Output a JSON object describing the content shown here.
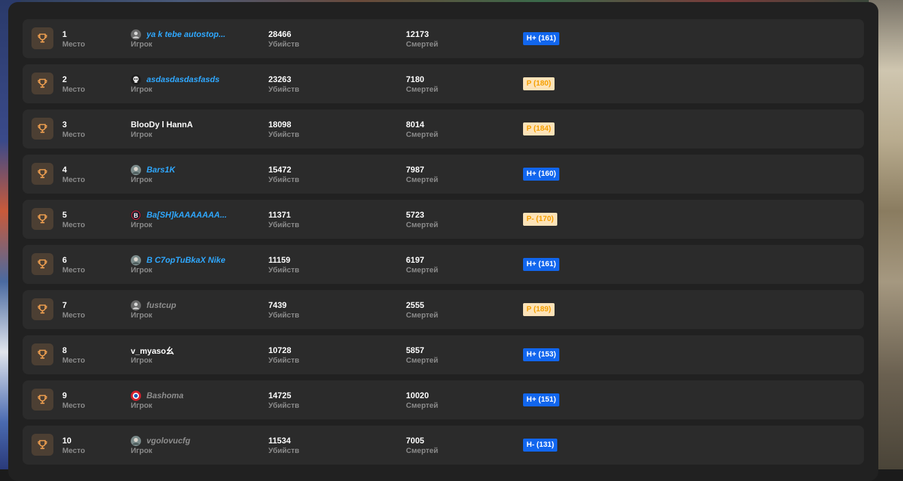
{
  "labels": {
    "place": "Место",
    "player": "Игрок",
    "kills": "Убийств",
    "deaths": "Смертей"
  },
  "rows": [
    {
      "place": "1",
      "player": "ya k tebe autostop...",
      "player_style": "link",
      "avatar": "default-avatar-icon",
      "kills": "28466",
      "deaths": "12173",
      "rank": "H+ (161)",
      "rank_color": "blue"
    },
    {
      "place": "2",
      "player": "asdasdasdasfasds",
      "player_style": "link",
      "avatar": "skull-avatar-icon",
      "kills": "23263",
      "deaths": "7180",
      "rank": "P (180)",
      "rank_color": "orange"
    },
    {
      "place": "3",
      "player": "BlooDy l HannA",
      "player_style": "plain",
      "avatar": "",
      "kills": "18098",
      "deaths": "8014",
      "rank": "P (184)",
      "rank_color": "orange"
    },
    {
      "place": "4",
      "player": "Bars1K",
      "player_style": "link",
      "avatar": "photo-avatar-icon",
      "kills": "15472",
      "deaths": "7987",
      "rank": "H+ (160)",
      "rank_color": "blue"
    },
    {
      "place": "5",
      "player": "Ba[SH]kAAAAAAA...",
      "player_style": "link",
      "avatar": "letter-b-avatar-icon",
      "kills": "11371",
      "deaths": "5723",
      "rank": "P- (170)",
      "rank_color": "orange"
    },
    {
      "place": "6",
      "player": "B C7opTuBkaX Nike",
      "player_style": "link",
      "avatar": "photo-avatar-icon",
      "kills": "11159",
      "deaths": "6197",
      "rank": "H+ (161)",
      "rank_color": "blue"
    },
    {
      "place": "7",
      "player": "fustcup",
      "player_style": "gray",
      "avatar": "default-avatar-icon",
      "kills": "7439",
      "deaths": "2555",
      "rank": "P (189)",
      "rank_color": "orange"
    },
    {
      "place": "8",
      "player": "v_myaso幺",
      "player_style": "plain",
      "avatar": "",
      "kills": "10728",
      "deaths": "5857",
      "rank": "H+ (153)",
      "rank_color": "blue"
    },
    {
      "place": "9",
      "player": "Bashoma",
      "player_style": "gray",
      "avatar": "club-logo-avatar-icon",
      "kills": "14725",
      "deaths": "10020",
      "rank": "H+ (151)",
      "rank_color": "blue"
    },
    {
      "place": "10",
      "player": "vgolovucfg",
      "player_style": "gray",
      "avatar": "photo-avatar-icon",
      "kills": "11534",
      "deaths": "7005",
      "rank": "H- (131)",
      "rank_color": "blue"
    }
  ],
  "colors": {
    "link": "#2fa8ff",
    "badge_blue": "#1166ee",
    "badge_orange_bg": "#fde3b8",
    "badge_orange_text": "#f5a000",
    "trophy": "#f0a050"
  }
}
